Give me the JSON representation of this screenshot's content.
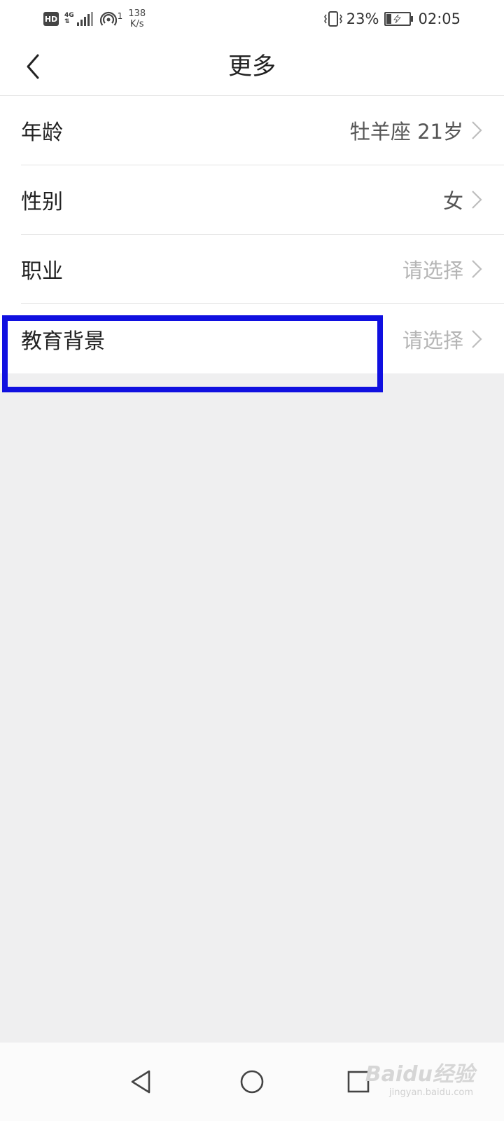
{
  "status_bar": {
    "hd": "HD",
    "network": "4G",
    "hotspot_count": "1",
    "speed_value": "138",
    "speed_unit": "K/s",
    "battery_percent": "23%",
    "battery_level": 0.23,
    "time": "02:05"
  },
  "header": {
    "title": "更多"
  },
  "settings": {
    "items": [
      {
        "label": "年龄",
        "value": "牡羊座 21岁"
      },
      {
        "label": "性别",
        "value": "女"
      },
      {
        "label": "职业",
        "value": "请选择"
      },
      {
        "label": "教育背景",
        "value": "请选择"
      }
    ]
  },
  "watermark": {
    "text": "Baidu经验",
    "url": "jingyan.baidu.com"
  },
  "colors": {
    "highlight": "#1010e0",
    "background": "#efeff0",
    "placeholder": "#b5b5b5"
  }
}
